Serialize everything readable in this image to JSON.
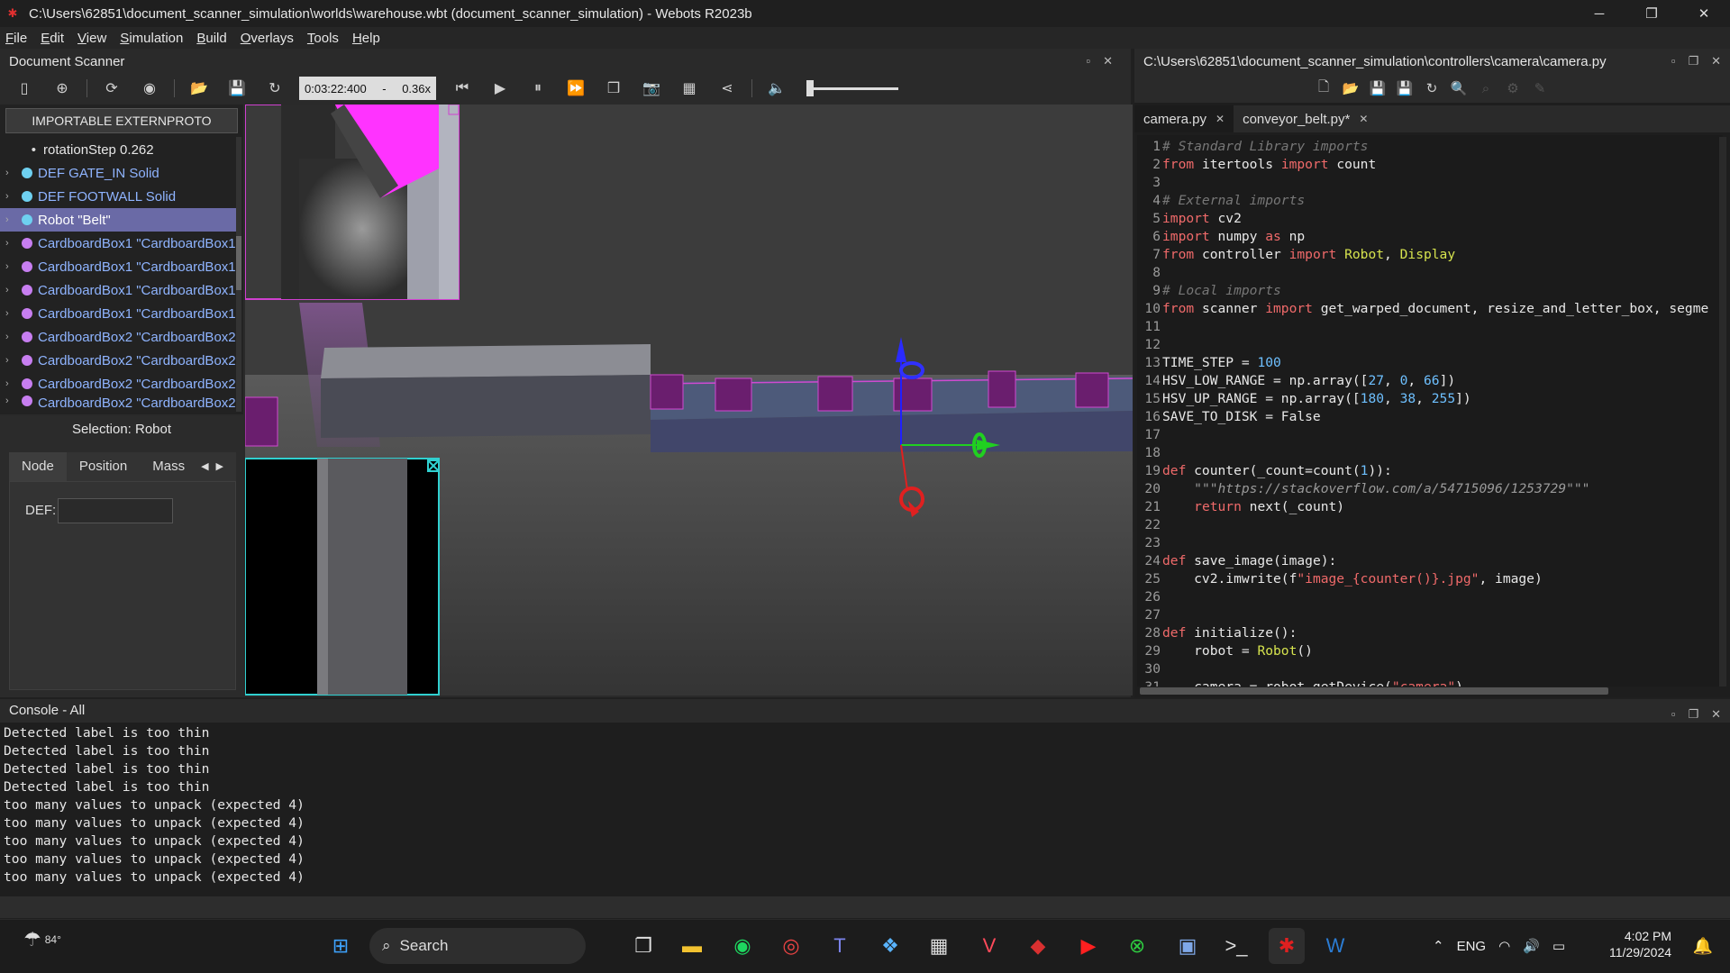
{
  "window": {
    "title": "C:\\Users\\62851\\document_scanner_simulation\\worlds\\warehouse.wbt (document_scanner_simulation) - Webots R2023b"
  },
  "menu": [
    "File",
    "Edit",
    "View",
    "Simulation",
    "Build",
    "Overlays",
    "Tools",
    "Help"
  ],
  "left_pane": {
    "title": "Document Scanner"
  },
  "toolbar": {
    "time": "0:03:22:400",
    "speed_sep": "-",
    "speed": "0.36x"
  },
  "scene_tree": {
    "externproto_button": "IMPORTABLE EXTERNPROTO",
    "items": [
      {
        "label": "rotationStep 0.262",
        "kind": "field"
      },
      {
        "label": "DEF GATE_IN Solid",
        "kind": "solid"
      },
      {
        "label": "DEF FOOTWALL Solid",
        "kind": "solid"
      },
      {
        "label": "Robot \"Belt\"",
        "kind": "robot",
        "selected": true
      },
      {
        "label": "CardboardBox1 \"CardboardBox1",
        "kind": "box"
      },
      {
        "label": "CardboardBox1 \"CardboardBox1",
        "kind": "box"
      },
      {
        "label": "CardboardBox1 \"CardboardBox1",
        "kind": "box"
      },
      {
        "label": "CardboardBox1 \"CardboardBox1",
        "kind": "box"
      },
      {
        "label": "CardboardBox2 \"CardboardBox2",
        "kind": "box"
      },
      {
        "label": "CardboardBox2 \"CardboardBox2",
        "kind": "box"
      },
      {
        "label": "CardboardBox2 \"CardboardBox2",
        "kind": "box"
      },
      {
        "label": "CardboardBox2 \"CardboardBox2",
        "kind": "box"
      }
    ]
  },
  "selection": {
    "title": "Selection: Robot",
    "tabs": [
      "Node",
      "Position",
      "Mass"
    ],
    "def_label": "DEF:",
    "def_value": ""
  },
  "editor": {
    "path": "C:\\Users\\62851\\document_scanner_simulation\\controllers\\camera\\camera.py",
    "tabs": [
      {
        "label": "camera.py",
        "active": true
      },
      {
        "label": "conveyor_belt.py*",
        "active": false
      }
    ]
  },
  "console": {
    "title": "Console - All",
    "lines": [
      "Detected label is too thin",
      "Detected label is too thin",
      "Detected label is too thin",
      "Detected label is too thin",
      "too many values to unpack (expected 4)",
      "too many values to unpack (expected 4)",
      "too many values to unpack (expected 4)",
      "too many values to unpack (expected 4)",
      "too many values to unpack (expected 4)"
    ]
  },
  "taskbar": {
    "weather": "84°",
    "search_label": "Search",
    "lang": "ENG",
    "time": "4:02 PM",
    "date": "11/29/2024"
  },
  "colors": {
    "accent": "#ff33ff",
    "selection": "#6a6aa6",
    "keyword": "#f06a6a",
    "number": "#6ec0ff",
    "class": "#d6e34e"
  }
}
